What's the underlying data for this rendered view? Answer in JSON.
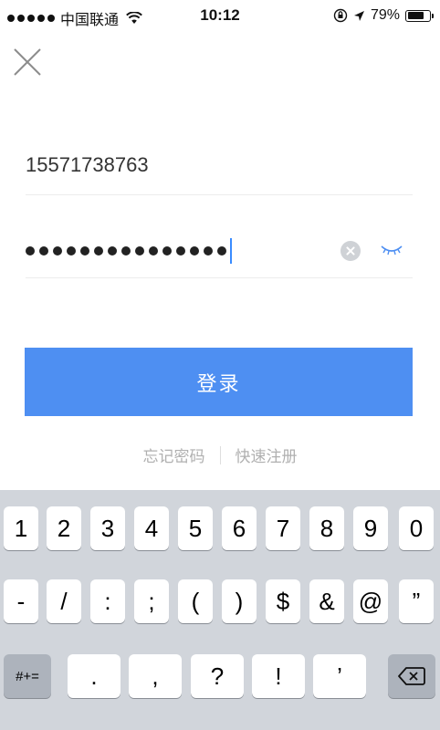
{
  "status_bar": {
    "carrier": "中国联通",
    "time": "10:12",
    "battery_text": "79%",
    "battery_level": 0.79,
    "icons": [
      "signal-dots-icon",
      "wifi-icon",
      "rotation-lock-icon",
      "location-arrow-icon",
      "battery-icon"
    ]
  },
  "form": {
    "phone_value": "15571738763",
    "password_length": 15,
    "login_label": "登录",
    "forgot_label": "忘记密码",
    "register_label": "快速注册"
  },
  "icons": {
    "close": "close-icon",
    "clear": "clear-input-icon",
    "toggle_visibility": "eye-closed-icon",
    "backspace": "backspace-icon"
  },
  "colors": {
    "primary": "#4e8ff2",
    "link_gray": "#b0b0b0",
    "keyboard_bg": "#d1d5db"
  },
  "keyboard": {
    "row1": [
      "1",
      "2",
      "3",
      "4",
      "5",
      "6",
      "7",
      "8",
      "9",
      "0"
    ],
    "row2": [
      "-",
      "/",
      ":",
      ";",
      "(",
      ")",
      "$",
      "&",
      "@",
      "”"
    ],
    "row3_left": "#+=",
    "row3_mid": [
      ".",
      ",",
      "?",
      "!",
      "’"
    ]
  }
}
